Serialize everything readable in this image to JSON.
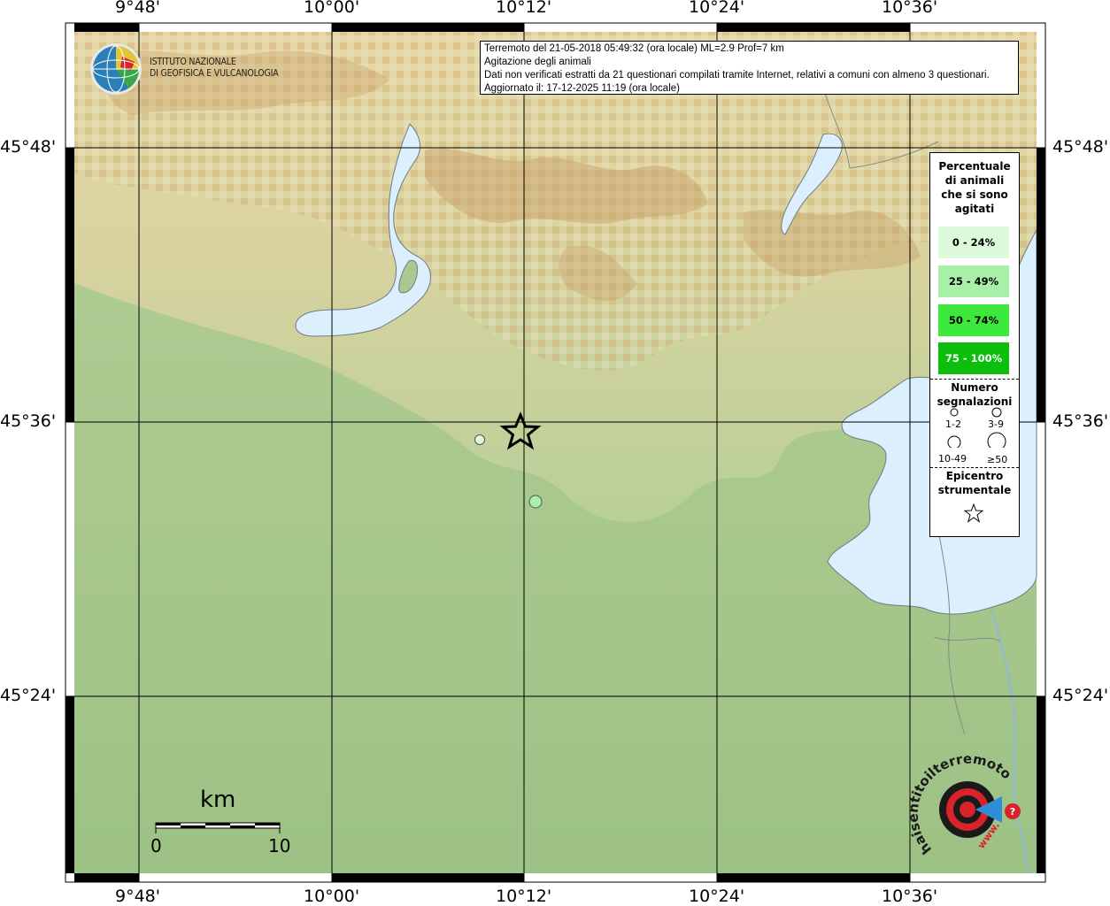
{
  "info": {
    "line1": "Terremoto del 21-05-2018 05:49:32 (ora locale) ML=2.9 Prof=7 km",
    "line2": "Agitazione degli animali",
    "line3": "Dati non verificati estratti da 21 questionari compilati tramite Internet, relativi a comuni con almeno 3 questionari.",
    "line4": "Aggiornato il: 17-12-2025 11:19 (ora locale)"
  },
  "institute": {
    "line1": "ISTITUTO NAZIONALE",
    "line2": "DI GEOFISICA E VULCANOLOGIA"
  },
  "axes": {
    "lon_ticks": [
      "9°48'",
      "10°00'",
      "10°12'",
      "10°24'",
      "10°36'"
    ],
    "lat_ticks": [
      "45°48'",
      "45°36'",
      "45°24'"
    ]
  },
  "legend": {
    "title": [
      "Percentuale",
      "di animali",
      "che si sono",
      "agitati"
    ],
    "classes": [
      {
        "label": "0 - 24%",
        "color": "#ddfadd"
      },
      {
        "label": "25 - 49%",
        "color": "#a8f0a8"
      },
      {
        "label": "50 - 74%",
        "color": "#3de83d"
      },
      {
        "label": "75 - 100%",
        "color": "#0cbf0c"
      }
    ],
    "count_title": [
      "Numero",
      "segnalazioni"
    ],
    "sizes": [
      "1-2",
      "3-9",
      "10-49",
      "≥50"
    ],
    "epicenter_title": [
      "Epicentro",
      "strumentale"
    ]
  },
  "scale": {
    "unit": "km",
    "min": "0",
    "max": "10"
  },
  "watermark": {
    "text": "haisentitoilterremoto.it",
    "prefix": "www."
  },
  "colors": {
    "water": "#dcefff",
    "plain": "#a9c990",
    "point_low": "#ddfadd",
    "point_mid": "#a8f0a8"
  },
  "observations": [
    {
      "label": "point-1",
      "class": "0 - 24%"
    },
    {
      "label": "point-2",
      "class": "25 - 49%"
    }
  ]
}
